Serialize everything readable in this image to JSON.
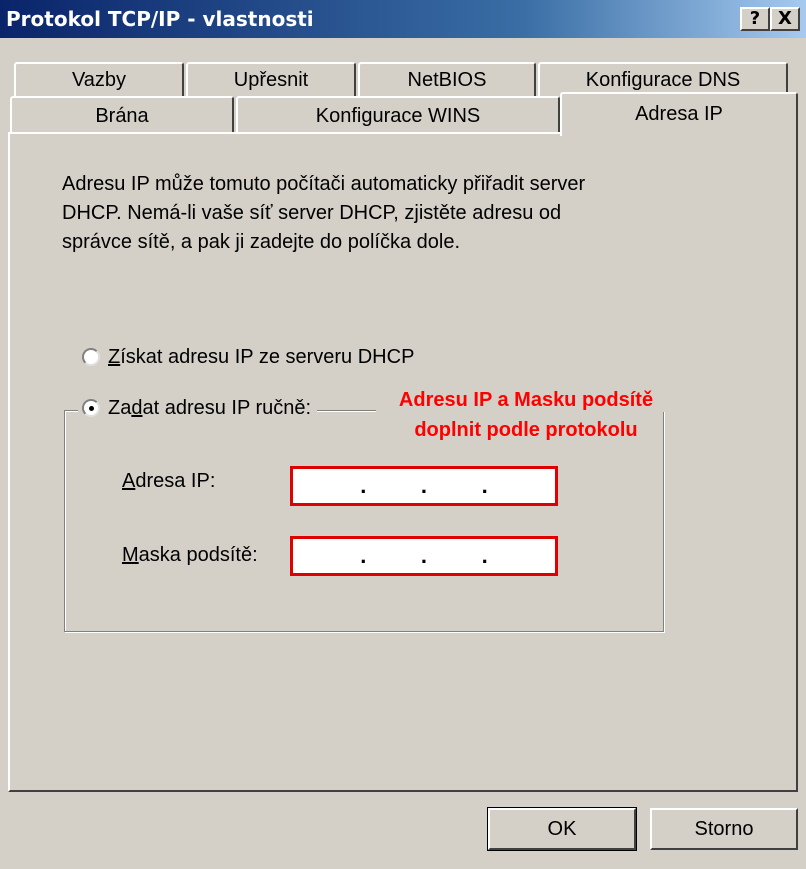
{
  "window": {
    "title": "Protokol TCP/IP - vlastnosti",
    "help_label": "?",
    "close_label": "X"
  },
  "tabs": {
    "row1": [
      {
        "label": "Vazby"
      },
      {
        "label": "Upřesnit"
      },
      {
        "label": "NetBIOS"
      },
      {
        "label": "Konfigurace DNS"
      }
    ],
    "row2": [
      {
        "label": "Brána"
      },
      {
        "label": "Konfigurace WINS"
      },
      {
        "label": "Adresa IP",
        "active": true
      }
    ]
  },
  "panel": {
    "description_lines": [
      "Adresu IP může tomuto počítači automaticky přiřadit server",
      "DHCP. Nemá-li vaše síť server DHCP, zjistěte adresu od",
      "správce sítě, a pak ji zadejte do políčka dole."
    ],
    "radio_dhcp": {
      "access_key": "Z",
      "rest": "ískat adresu IP ze serveru DHCP",
      "checked": false
    },
    "radio_manual": {
      "prefix": "Za",
      "access_key": "d",
      "rest": "at adresu IP ručně:",
      "checked": true
    },
    "annotation_lines": [
      "Adresu IP a Masku podsítě",
      "doplnit podle protokolu"
    ],
    "ip_address": {
      "access_key": "A",
      "label_rest": "dresa IP:",
      "dots": [
        ".",
        ".",
        "."
      ]
    },
    "subnet_mask": {
      "access_key": "M",
      "label_rest": "aska podsítě:",
      "dots": [
        ".",
        ".",
        "."
      ]
    }
  },
  "buttons": {
    "ok": "OK",
    "cancel": "Storno"
  },
  "colors": {
    "titlebar_start": "#0a246a",
    "titlebar_end": "#a6caf0",
    "annotation": "#ff0000",
    "field_highlight": "#e00000",
    "face": "#d4d0c8"
  }
}
